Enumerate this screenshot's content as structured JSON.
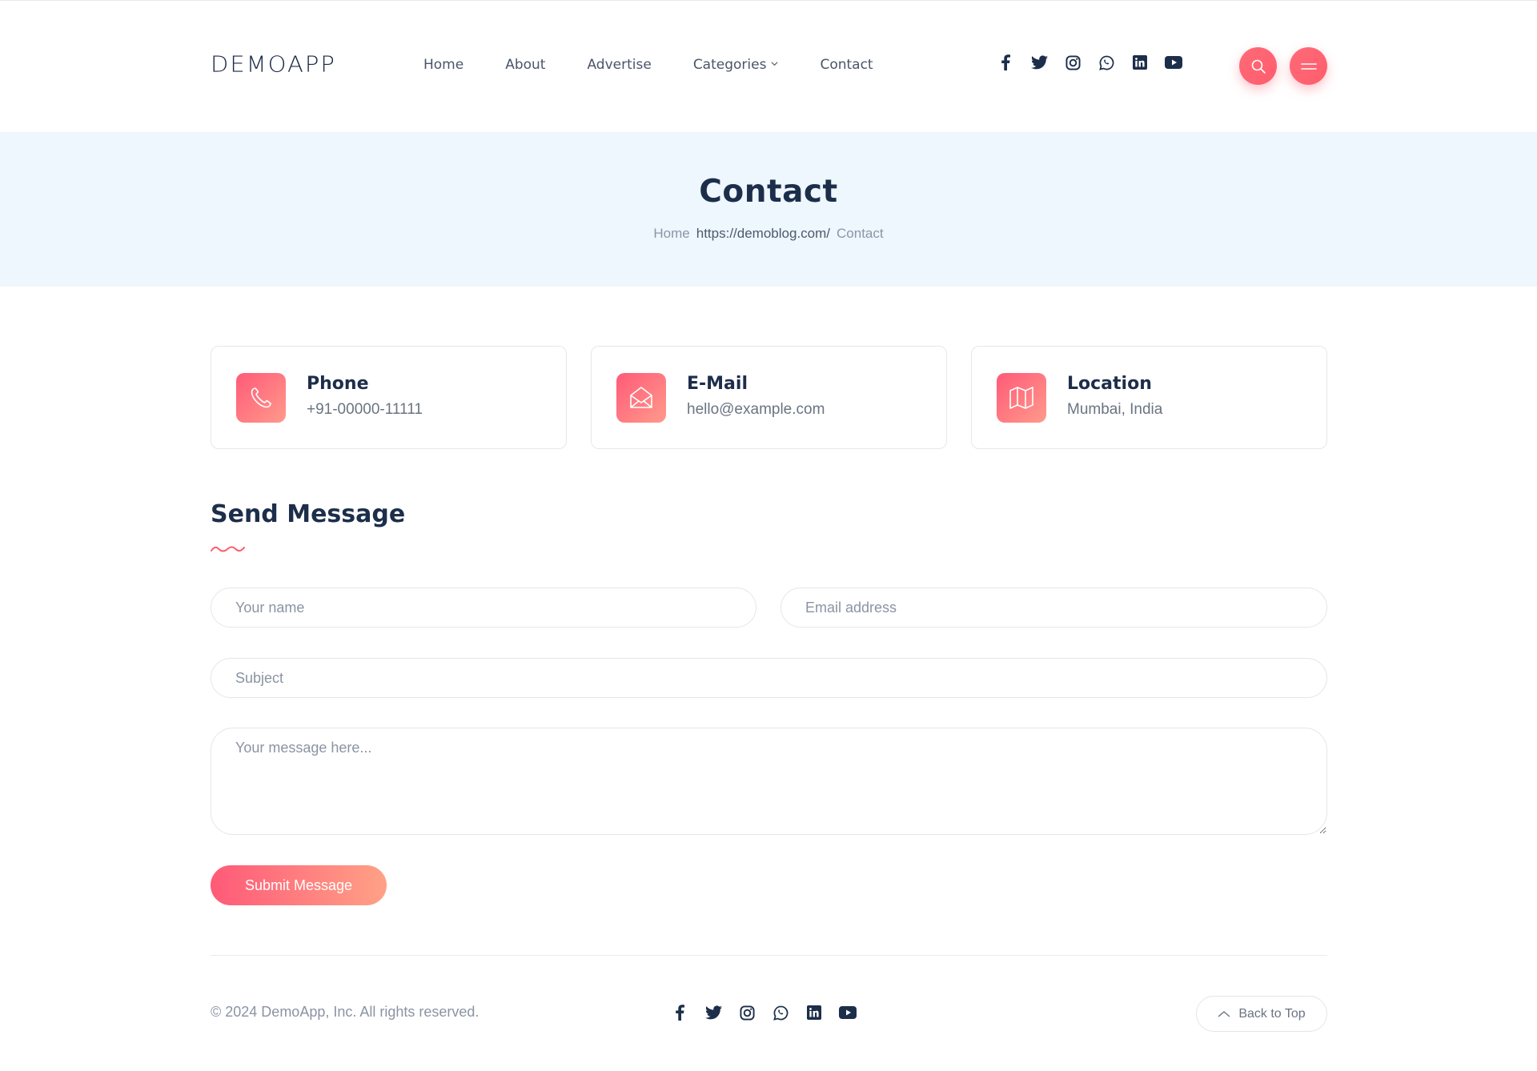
{
  "header": {
    "logo": "DEMOAPP",
    "nav": [
      "Home",
      "About",
      "Advertise",
      "Categories",
      "Contact"
    ],
    "social_icons": [
      "facebook-icon",
      "twitter-icon",
      "instagram-icon",
      "whatsapp-icon",
      "linkedin-icon",
      "youtube-icon"
    ]
  },
  "banner": {
    "title": "Contact",
    "breadcrumb": [
      "Home",
      "https://demoblog.com/",
      "Contact"
    ]
  },
  "cards": [
    {
      "title": "Phone",
      "value": "+91-00000-11111",
      "icon": "phone-icon"
    },
    {
      "title": "E-Mail",
      "value": "hello@example.com",
      "icon": "envelope-open-icon"
    },
    {
      "title": "Location",
      "value": "Mumbai, India",
      "icon": "map-icon"
    }
  ],
  "form": {
    "title": "Send Message",
    "name_placeholder": "Your name",
    "email_placeholder": "Email address",
    "subject_placeholder": "Subject",
    "message_placeholder": "Your message here...",
    "submit_label": "Submit Message"
  },
  "footer": {
    "copyright": "© 2024 DemoApp, Inc. All rights reserved.",
    "back_to_top": "Back to Top"
  },
  "colors": {
    "accent": "#ff5d6c",
    "heading": "#1c2e4a",
    "banner_bg": "#eef6fe"
  }
}
